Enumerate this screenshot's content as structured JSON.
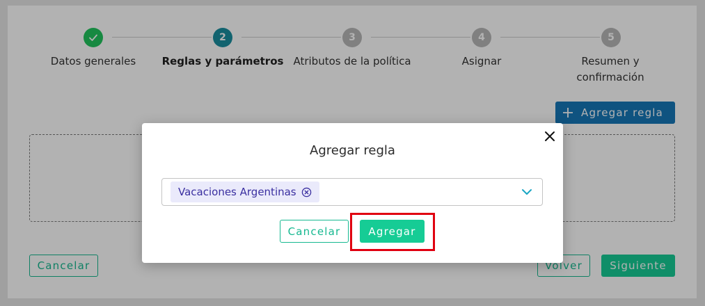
{
  "stepper": {
    "steps": [
      {
        "number": "",
        "label": "Datos generales",
        "status": "completed",
        "icon": "check-icon"
      },
      {
        "number": "2",
        "label": "Reglas y parámetros",
        "status": "active"
      },
      {
        "number": "3",
        "label": "Atributos de la política",
        "status": "pending"
      },
      {
        "number": "4",
        "label": "Asignar",
        "status": "pending"
      },
      {
        "number": "5",
        "label": "Resumen y confirmación",
        "status": "pending"
      }
    ]
  },
  "actions": {
    "add_rule": "Agregar regla",
    "add_rule_icon": "plus-icon"
  },
  "footer": {
    "cancel": "Cancelar",
    "back": "Volver",
    "next": "Siguiente"
  },
  "modal": {
    "title": "Agregar regla",
    "close_icon": "close-icon",
    "select": {
      "selected_chip": "Vacaciones Argentinas",
      "chip_remove_icon": "circle-x-icon",
      "dropdown_icon": "chevron-down-icon"
    },
    "cancel": "Cancelar",
    "confirm": "Agregar"
  },
  "colors": {
    "completed": "#22c55e",
    "active": "#1a8fa0",
    "pending": "#b8b8b8",
    "primary_blue": "#1677b8",
    "accent_green": "#16cc95",
    "chip_text": "#3a2fa0",
    "highlight": "#e00010"
  }
}
